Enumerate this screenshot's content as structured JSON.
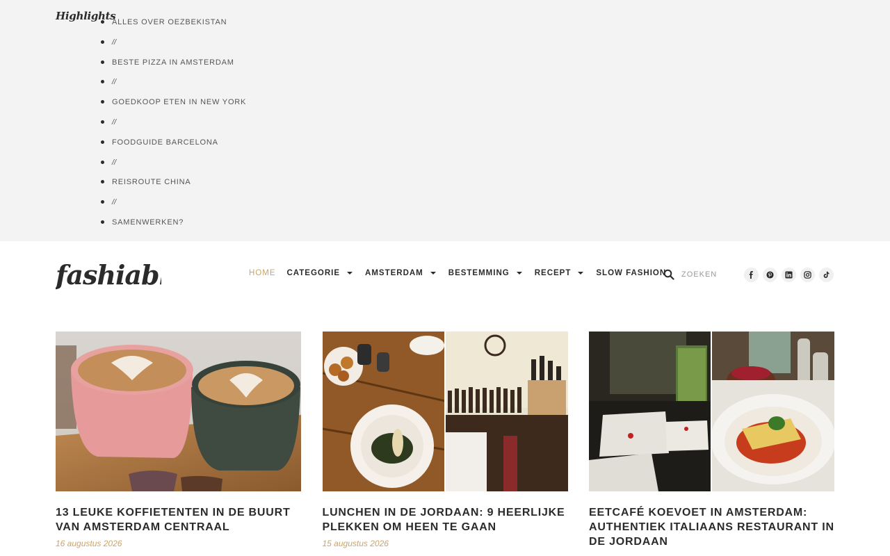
{
  "highlights": {
    "title": "Highlights",
    "items": [
      "ALLES OVER OEZBEKISTAN",
      "//",
      "BESTE PIZZA IN AMSTERDAM",
      "//",
      "GOEDKOOP ETEN IN NEW YORK",
      "//",
      "FOODGUIDE BARCELONA",
      "//",
      "REISROUTE CHINA",
      "//",
      "SAMENWERKEN?"
    ]
  },
  "header": {
    "logo_text": "fashiable",
    "nav": [
      {
        "label": "HOME",
        "active": true,
        "dropdown": false
      },
      {
        "label": "CATEGORIE",
        "active": false,
        "dropdown": true
      },
      {
        "label": "AMSTERDAM",
        "active": false,
        "dropdown": true
      },
      {
        "label": "BESTEMMING",
        "active": false,
        "dropdown": true
      },
      {
        "label": "RECEPT",
        "active": false,
        "dropdown": true
      },
      {
        "label": "SLOW FASHION",
        "active": false,
        "dropdown": false
      }
    ],
    "search": {
      "placeholder": "ZOEKEN",
      "icon": "search-icon"
    },
    "socials": [
      "facebook-icon",
      "pinterest-icon",
      "linkedin-icon",
      "instagram-icon",
      "tiktok-icon"
    ]
  },
  "posts": [
    {
      "title": "13 LEUKE KOFFIETENTEN IN DE BUURT VAN AMSTERDAM CENTRAAL",
      "date": "16 augustus 2026"
    },
    {
      "title": "LUNCHEN IN DE JORDAAN: 9 HEERLIJKE PLEKKEN OM HEEN TE GAAN",
      "date": "15 augustus 2026"
    },
    {
      "title": "EETCAFÉ KOEVOET IN AMSTERDAM: AUTHENTIEK ITALIAANS RESTAURANT IN DE JORDAAN",
      "date": ""
    }
  ],
  "colors": {
    "accent": "#c9a46b",
    "text": "#2b2b2b",
    "topbar_bg": "#f3f3f3"
  }
}
